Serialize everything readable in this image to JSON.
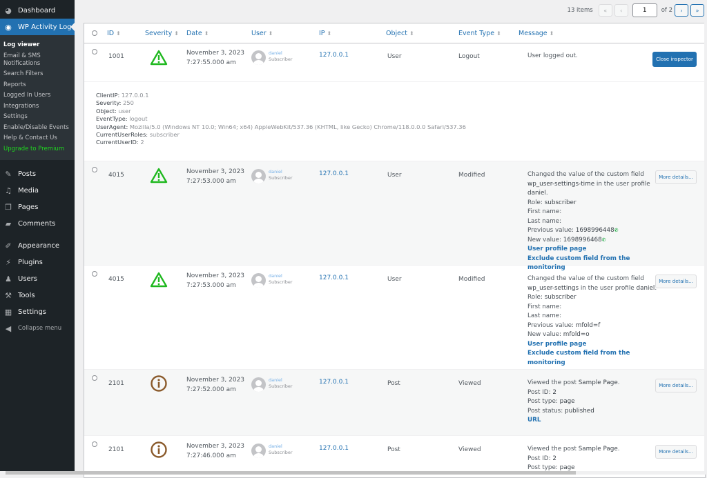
{
  "sidebar": {
    "dashboard": {
      "label": "Dashboard",
      "icon": "dashboard-icon"
    },
    "plugin": {
      "label": "WP Activity Log",
      "icon": "eye-icon"
    },
    "submenu": [
      {
        "label": "Log viewer",
        "current": true
      },
      {
        "label": "Email & SMS Notifications"
      },
      {
        "label": "Search Filters"
      },
      {
        "label": "Reports"
      },
      {
        "label": "Logged In Users"
      },
      {
        "label": "Integrations"
      },
      {
        "label": "Settings"
      },
      {
        "label": "Enable/Disable Events"
      },
      {
        "label": "Help & Contact Us"
      },
      {
        "label": "Upgrade to Premium",
        "premium": true
      }
    ],
    "menu": [
      {
        "label": "Posts",
        "icon": "pin-icon"
      },
      {
        "label": "Media",
        "icon": "media-icon"
      },
      {
        "label": "Pages",
        "icon": "pages-icon"
      },
      {
        "label": "Comments",
        "icon": "comment-icon"
      },
      {
        "label": "Appearance",
        "icon": "paintbrush-icon"
      },
      {
        "label": "Plugins",
        "icon": "plugin-icon"
      },
      {
        "label": "Users",
        "icon": "user-icon"
      },
      {
        "label": "Tools",
        "icon": "wrench-icon"
      },
      {
        "label": "Settings",
        "icon": "settings-icon"
      }
    ],
    "collapse": "Collapse menu"
  },
  "pagination": {
    "items": "13 items",
    "first": "«",
    "prev": "‹",
    "current_page": "1",
    "of": "of 2",
    "next": "›",
    "last": "»"
  },
  "table": {
    "headers": {
      "id": "ID",
      "severity": "Severity",
      "date": "Date",
      "user": "User",
      "ip": "IP",
      "object": "Object",
      "event_type": "Event Type",
      "message": "Message"
    },
    "sort_glyph": "⬍",
    "rows": [
      {
        "id": "1001",
        "severity": "warning",
        "date": "November 3, 2023",
        "time": "7:27:55.000 am",
        "user": "daniel",
        "role": "Subscriber",
        "ip": "127.0.0.1",
        "object": "User",
        "event_type": "Logout",
        "message": "User logged out.",
        "button": "Close inspector"
      },
      {
        "id": "4015",
        "severity": "warning",
        "date": "November 3, 2023",
        "time": "7:27:53.000 am",
        "user": "daniel",
        "role": "Subscriber",
        "ip": "127.0.0.1",
        "object": "User",
        "event_type": "Modified",
        "msg_pre": "Changed the value of the custom field ",
        "msg_field": "wp_user-settings-time",
        "msg_mid": " in the user profile ",
        "msg_user": "daniel",
        "msg_end": ".",
        "role_line": [
          "Role: ",
          "subscriber"
        ],
        "first_name": "First name:",
        "last_name": "Last name:",
        "prev": [
          "Previous value: ",
          "1698996448"
        ],
        "new": [
          "New value: ",
          "1698996468"
        ],
        "link1": "User profile page",
        "link2": "Exclude custom field from the monitoring",
        "button": "More details..."
      },
      {
        "id": "4015",
        "severity": "warning",
        "date": "November 3, 2023",
        "time": "7:27:53.000 am",
        "user": "daniel",
        "role": "Subscriber",
        "ip": "127.0.0.1",
        "object": "User",
        "event_type": "Modified",
        "msg_pre": "Changed the value of the custom field ",
        "msg_field": "wp_user-settings",
        "msg_mid": " in the user profile ",
        "msg_user": "daniel",
        "msg_end": ".",
        "role_line": [
          "Role: ",
          "subscriber"
        ],
        "first_name": "First name:",
        "last_name": "Last name:",
        "prev": [
          "Previous value: ",
          "mfold=f"
        ],
        "new": [
          "New value: ",
          "mfold=o"
        ],
        "link1": "User profile page",
        "link2": "Exclude custom field from the monitoring",
        "button": "More details..."
      },
      {
        "id": "2101",
        "severity": "info",
        "date": "November 3, 2023",
        "time": "7:27:52.000 am",
        "user": "daniel",
        "role": "Subscriber",
        "ip": "127.0.0.1",
        "object": "Post",
        "event_type": "Viewed",
        "msg_pre": "Viewed the post ",
        "msg_post": "Sample Page",
        "msg_end": ".",
        "post_id": [
          "Post ID: ",
          "2"
        ],
        "post_type": [
          "Post type: ",
          "page"
        ],
        "post_status": [
          "Post status: ",
          "published"
        ],
        "link": "URL",
        "button": "More details..."
      },
      {
        "id": "2101",
        "severity": "info",
        "date": "November 3, 2023",
        "time": "7:27:46.000 am",
        "user": "daniel",
        "role": "Subscriber",
        "ip": "127.0.0.1",
        "object": "Post",
        "event_type": "Viewed",
        "msg_pre": "Viewed the post ",
        "msg_post": "Sample Page",
        "msg_end": ".",
        "post_id": [
          "Post ID: ",
          "2"
        ],
        "post_type": [
          "Post type: ",
          "page"
        ],
        "button": "More details..."
      }
    ],
    "inspector": [
      {
        "k": "ClientIP:",
        "v": " 127.0.0.1"
      },
      {
        "k": "Severity:",
        "v": " 250"
      },
      {
        "k": "Object:",
        "v": " user"
      },
      {
        "k": "EventType:",
        "v": " logout"
      },
      {
        "k": "UserAgent:",
        "v": " Mozilla/5.0 (Windows NT 10.0; Win64; x64) AppleWebKit/537.36 (KHTML, like Gecko) Chrome/118.0.0.0 Safari/537.36"
      },
      {
        "k": "CurrentUserRoles:",
        "v": " subscriber"
      },
      {
        "k": "CurrentUserID:",
        "v": " 2"
      }
    ]
  },
  "colors": {
    "warning": "#1fb81f",
    "info": "#8a5a2b",
    "accent": "#2271b1"
  }
}
